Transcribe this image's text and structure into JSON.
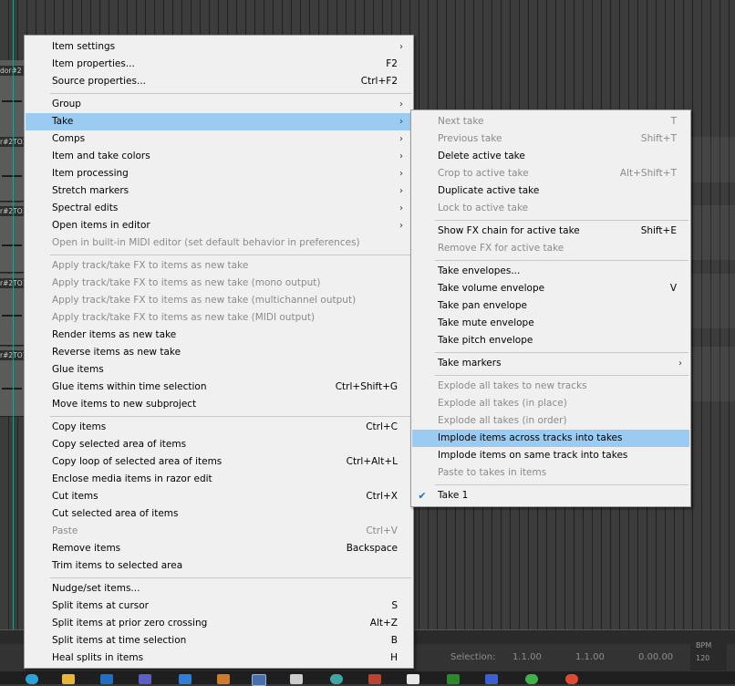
{
  "context_menu": [
    {
      "type": "item",
      "label": "Item settings",
      "submenu": true
    },
    {
      "type": "item",
      "label": "Item properties...",
      "shortcut": "F2"
    },
    {
      "type": "item",
      "label": "Source properties...",
      "shortcut": "Ctrl+F2"
    },
    {
      "type": "sep"
    },
    {
      "type": "item",
      "label": "Group",
      "submenu": true
    },
    {
      "type": "item",
      "label": "Take",
      "submenu": true,
      "highlight": true
    },
    {
      "type": "item",
      "label": "Comps",
      "submenu": true
    },
    {
      "type": "item",
      "label": "Item and take colors",
      "submenu": true
    },
    {
      "type": "item",
      "label": "Item processing",
      "submenu": true
    },
    {
      "type": "item",
      "label": "Stretch markers",
      "submenu": true
    },
    {
      "type": "item",
      "label": "Spectral edits",
      "submenu": true
    },
    {
      "type": "item",
      "label": "Open items in editor",
      "submenu": true
    },
    {
      "type": "item",
      "label": "Open in built-in MIDI editor (set default behavior in preferences)",
      "disabled": true
    },
    {
      "type": "sep"
    },
    {
      "type": "item",
      "label": "Apply track/take FX to items as new take",
      "disabled": true
    },
    {
      "type": "item",
      "label": "Apply track/take FX to items as new take (mono output)",
      "disabled": true
    },
    {
      "type": "item",
      "label": "Apply track/take FX to items as new take (multichannel output)",
      "disabled": true
    },
    {
      "type": "item",
      "label": "Apply track/take FX to items as new take (MIDI output)",
      "disabled": true
    },
    {
      "type": "item",
      "label": "Render items as new take"
    },
    {
      "type": "item",
      "label": "Reverse items as new take"
    },
    {
      "type": "item",
      "label": "Glue items"
    },
    {
      "type": "item",
      "label": "Glue items within time selection",
      "shortcut": "Ctrl+Shift+G"
    },
    {
      "type": "item",
      "label": "Move items to new subproject"
    },
    {
      "type": "sep"
    },
    {
      "type": "item",
      "label": "Copy items",
      "shortcut": "Ctrl+C"
    },
    {
      "type": "item",
      "label": "Copy selected area of items"
    },
    {
      "type": "item",
      "label": "Copy loop of selected area of items",
      "shortcut": "Ctrl+Alt+L"
    },
    {
      "type": "item",
      "label": "Enclose media items in razor edit"
    },
    {
      "type": "item",
      "label": "Cut items",
      "shortcut": "Ctrl+X"
    },
    {
      "type": "item",
      "label": "Cut selected area of items"
    },
    {
      "type": "item",
      "label": "Paste",
      "shortcut": "Ctrl+V",
      "disabled": true
    },
    {
      "type": "item",
      "label": "Remove items",
      "shortcut": "Backspace"
    },
    {
      "type": "item",
      "label": "Trim items to selected area"
    },
    {
      "type": "sep"
    },
    {
      "type": "item",
      "label": "Nudge/set items..."
    },
    {
      "type": "item",
      "label": "Split items at cursor",
      "shortcut": "S"
    },
    {
      "type": "item",
      "label": "Split items at prior zero crossing",
      "shortcut": "Alt+Z"
    },
    {
      "type": "item",
      "label": "Split items at time selection",
      "shortcut": "B"
    },
    {
      "type": "item",
      "label": "Heal splits in items",
      "shortcut": "H"
    }
  ],
  "take_submenu": [
    {
      "type": "item",
      "label": "Next take",
      "shortcut": "T",
      "disabled": true
    },
    {
      "type": "item",
      "label": "Previous take",
      "shortcut": "Shift+T",
      "disabled": true
    },
    {
      "type": "item",
      "label": "Delete active take"
    },
    {
      "type": "item",
      "label": "Crop to active take",
      "shortcut": "Alt+Shift+T",
      "disabled": true
    },
    {
      "type": "item",
      "label": "Duplicate active take"
    },
    {
      "type": "item",
      "label": "Lock to active take",
      "disabled": true
    },
    {
      "type": "sep"
    },
    {
      "type": "item",
      "label": "Show FX chain for active take",
      "shortcut": "Shift+E"
    },
    {
      "type": "item",
      "label": "Remove FX for active take",
      "disabled": true
    },
    {
      "type": "sep"
    },
    {
      "type": "item",
      "label": "Take envelopes..."
    },
    {
      "type": "item",
      "label": "Take volume envelope",
      "shortcut": "V"
    },
    {
      "type": "item",
      "label": "Take pan envelope"
    },
    {
      "type": "item",
      "label": "Take mute envelope"
    },
    {
      "type": "item",
      "label": "Take pitch envelope"
    },
    {
      "type": "sep"
    },
    {
      "type": "item",
      "label": "Take markers",
      "submenu": true
    },
    {
      "type": "sep"
    },
    {
      "type": "item",
      "label": "Explode all takes to new tracks",
      "disabled": true
    },
    {
      "type": "item",
      "label": "Explode all takes (in place)",
      "disabled": true
    },
    {
      "type": "item",
      "label": "Explode all takes (in order)",
      "disabled": true
    },
    {
      "type": "item",
      "label": "Implode items across tracks into takes",
      "highlight": true
    },
    {
      "type": "item",
      "label": "Implode items on same track into takes"
    },
    {
      "type": "item",
      "label": "Paste to takes in items",
      "disabled": true
    },
    {
      "type": "sep"
    },
    {
      "type": "item",
      "label": "Take 1",
      "checked": true
    }
  ],
  "track_item_labels": [
    "dor#2",
    "r#2TO1",
    "r#2TO1",
    "r#2TO1",
    "r#2TO1"
  ],
  "status_bar": {
    "selection_label": "Selection:",
    "sel_start": "1.1.00",
    "sel_end": "1.1.00",
    "sel_length": "0.00.00",
    "bpm_label": "BPM",
    "bpm_value": "120"
  },
  "colors": {
    "highlight": "#9ccbf2",
    "menu_bg": "#f0f0f0",
    "disabled_text": "#8a8a8a"
  }
}
